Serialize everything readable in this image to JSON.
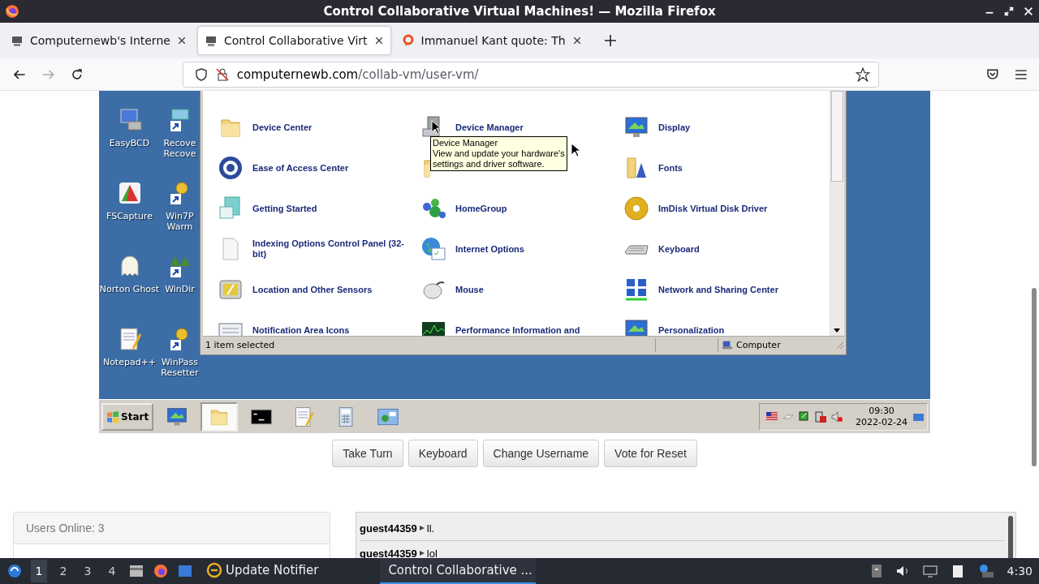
{
  "window": {
    "title": "Control Collaborative Virtual Machines! — Mozilla Firefox"
  },
  "tabs": [
    {
      "label": "Computernewb's Interne",
      "selected": false
    },
    {
      "label": "Control Collaborative Virt",
      "selected": true
    },
    {
      "label": "Immanuel Kant quote: Th",
      "selected": false
    }
  ],
  "address_bar": {
    "domain": "computernewb.com",
    "path": "/collab-vm/user-vm/"
  },
  "vm": {
    "desktop_icons": [
      {
        "label": "EasyBCD",
        "kind": "computer"
      },
      {
        "label": "FSCapture",
        "kind": "capture"
      },
      {
        "label": "Norton Ghost",
        "kind": "ghost"
      },
      {
        "label": "Notepad++",
        "kind": "notepad"
      },
      {
        "label": "Recove\nRecove",
        "kind": "shortcut"
      },
      {
        "label": "Win7P\nWarm",
        "kind": "key"
      },
      {
        "label": "WinDir",
        "kind": "tree"
      },
      {
        "label": "WinPass\nResetter",
        "kind": "key"
      }
    ],
    "control_panel": {
      "items": [
        {
          "label": "Device Center",
          "kind": "folder"
        },
        {
          "label": "Device Manager",
          "kind": "device"
        },
        {
          "label": "Display",
          "kind": "monitor"
        },
        {
          "label": "Ease of Access Center",
          "kind": "access"
        },
        {
          "kind": "folder"
        },
        {
          "label": "Fonts",
          "kind": "fonts"
        },
        {
          "label": "Getting Started",
          "kind": "start"
        },
        {
          "label": "HomeGroup",
          "kind": "homegroup"
        },
        {
          "label": "ImDisk Virtual Disk Driver",
          "kind": "disc"
        },
        {
          "label": "Indexing Options Control Panel (32-bit)",
          "kind": "document"
        },
        {
          "label": "Internet Options",
          "kind": "globe"
        },
        {
          "label": "Keyboard",
          "kind": "keyboard"
        },
        {
          "label": "Location and Other Sensors",
          "kind": "sensor"
        },
        {
          "label": "Mouse",
          "kind": "mouse"
        },
        {
          "label": "Network and Sharing Center",
          "kind": "network"
        },
        {
          "label": "Notification Area Icons",
          "kind": "notify"
        },
        {
          "label": "Performance Information and",
          "kind": "perf"
        },
        {
          "label": "Personalization",
          "kind": "monitor"
        }
      ],
      "tooltip": {
        "title": "Device Manager",
        "text": "View and update your hardware's\nsettings and driver software."
      },
      "status": {
        "selection": "1 item selected",
        "zone": "Computer"
      }
    },
    "taskbar": {
      "start": "Start",
      "buttons": [
        {
          "kind": "monitor",
          "selected": false
        },
        {
          "kind": "folder",
          "selected": true
        },
        {
          "kind": "console",
          "selected": false
        },
        {
          "kind": "notepad",
          "selected": false
        },
        {
          "kind": "calculator",
          "selected": false
        },
        {
          "kind": "control",
          "selected": false
        }
      ],
      "clock": {
        "time": "09:30",
        "date": "2022-02-24"
      }
    }
  },
  "actions": [
    "Take Turn",
    "Keyboard",
    "Change Username",
    "Vote for Reset"
  ],
  "users_panel": {
    "title": "Users Online: 3"
  },
  "chat": [
    {
      "user": "guest44359",
      "message": "ll."
    },
    {
      "user": "guest44359",
      "message": "lol"
    }
  ],
  "os_taskbar": {
    "workspaces": [
      {
        "label": "1",
        "selected": true
      },
      {
        "label": "2",
        "selected": false
      },
      {
        "label": "3",
        "selected": false
      },
      {
        "label": "4",
        "selected": false
      }
    ],
    "tasks": [
      {
        "label": "Update Notifier",
        "kind": "updater",
        "selected": false
      },
      {
        "label": "Control Collaborative ...",
        "kind": "firefox",
        "selected": true
      }
    ],
    "clock": "4:30"
  }
}
